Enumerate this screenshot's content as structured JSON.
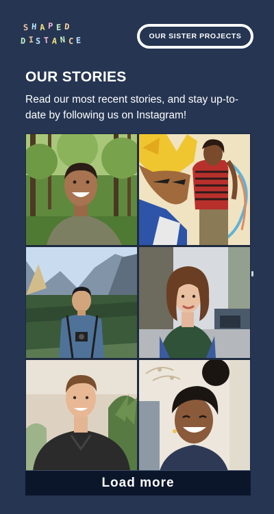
{
  "header": {
    "logo_text": "SHAPED DISTANCE",
    "sister_projects_label": "OUR SISTER PROJECTS"
  },
  "stories": {
    "title": "OUR STORIES",
    "description": "Read our most recent stories, and stay up-to-date by following us on Instagram!",
    "load_more_label": "Load more",
    "posts": [
      {
        "name": "story-photo-1",
        "subject": "smiling man in forest"
      },
      {
        "name": "story-photo-2",
        "subject": "woman posing with illustrated character"
      },
      {
        "name": "story-photo-3",
        "subject": "man with camera in mountain valley"
      },
      {
        "name": "story-photo-4",
        "subject": "curly-haired woman on city street"
      },
      {
        "name": "story-photo-5",
        "subject": "man in dark jacket"
      },
      {
        "name": "story-photo-6",
        "subject": "smiling woman with hair bun"
      }
    ]
  },
  "colors": {
    "background": "#253552",
    "button_dark": "#0b162b",
    "text": "#ffffff"
  }
}
